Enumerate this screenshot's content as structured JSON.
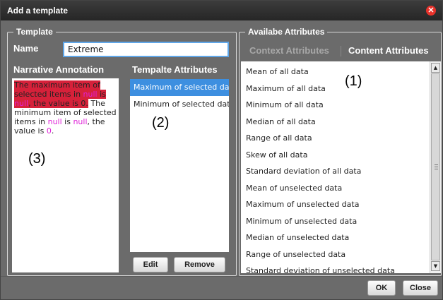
{
  "dialog": {
    "title": "Add a template",
    "close_icon": "close-icon"
  },
  "template_group": {
    "legend": "Template",
    "name_label": "Name",
    "name_value": "Extreme"
  },
  "narrative": {
    "heading": "Narrative Annotation",
    "annotations": [
      {
        "text_parts": [
          {
            "text": "The maximum item of selected items in ",
            "style": "hl"
          },
          {
            "text": "null",
            "style": "pinkhl"
          },
          {
            "text": " is ",
            "style": "hl"
          },
          {
            "text": "null",
            "style": "pinkhl"
          },
          {
            "text": ", the value is 0.",
            "style": "hl"
          }
        ]
      },
      {
        "text_parts": [
          {
            "text": "The minimum item of selected items in ",
            "style": "normal"
          },
          {
            "text": "null",
            "style": "pink"
          },
          {
            "text": " is ",
            "style": "normal"
          },
          {
            "text": "null",
            "style": "pink"
          },
          {
            "text": ", the value is ",
            "style": "normal"
          },
          {
            "text": "0",
            "style": "pink"
          },
          {
            "text": ".",
            "style": "normal"
          }
        ]
      }
    ]
  },
  "template_attributes": {
    "heading": "Tempalte Attributes",
    "items": [
      {
        "label": "Maximum of selected data",
        "selected": true
      },
      {
        "label": "Minimum of selected data",
        "selected": false
      }
    ],
    "edit_label": "Edit",
    "remove_label": "Remove"
  },
  "available": {
    "legend": "Availabe Attributes",
    "tab_context": "Context Attributes",
    "tab_content": "Content Attributes",
    "items": [
      "Mean of all data",
      "Maximum of all data",
      "Minimum of all data",
      "Median of all data",
      "Range of all data",
      "Skew of all data",
      "Standard deviation of all data",
      "Mean of unselected data",
      "Maximum of unselected data",
      "Minimum of unselected data",
      "Median of unselected data",
      "Range of unselected data",
      "Standard deviation of unselected data"
    ]
  },
  "callouts": {
    "c1": "(1)",
    "c2": "(2)",
    "c3": "(3)"
  },
  "footer": {
    "ok_label": "OK",
    "close_label": "Close"
  },
  "colors": {
    "selection": "#3d8fe0",
    "highlight": "#d6213a",
    "null_text": "#e020d8",
    "close_icon": "#e8322b"
  }
}
